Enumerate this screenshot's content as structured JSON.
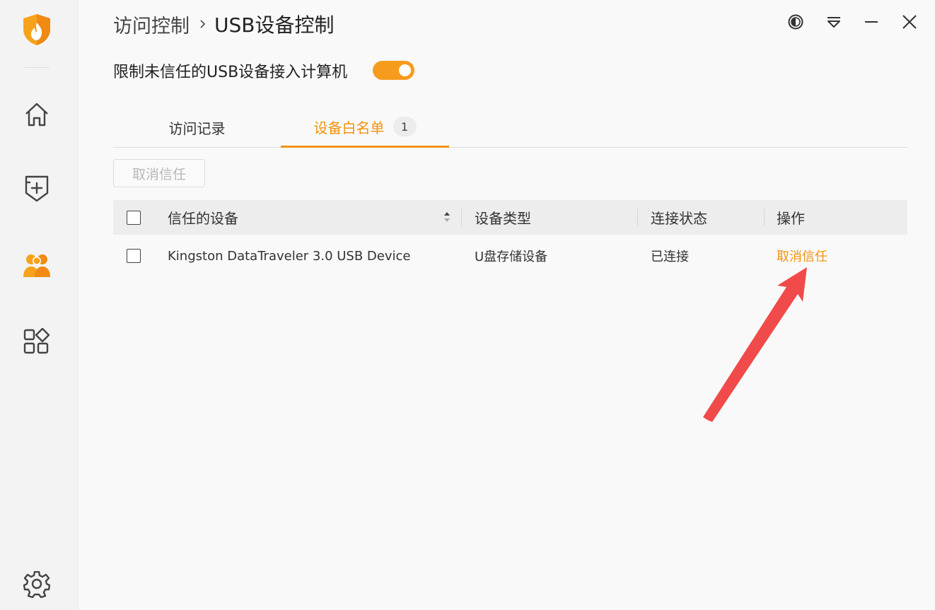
{
  "window": {
    "breadcrumb_parent": "访问控制",
    "breadcrumb_current": "USB设备控制",
    "controls": [
      "theme-icon",
      "menu-icon",
      "minimize-icon",
      "close-icon"
    ]
  },
  "sidebar": {
    "items": [
      {
        "icon": "home-icon",
        "active": false
      },
      {
        "icon": "shield-plus-icon",
        "active": false
      },
      {
        "icon": "users-icon",
        "active": true
      },
      {
        "icon": "apps-icon",
        "active": false
      }
    ],
    "footer_icon": "settings-icon"
  },
  "restriction": {
    "label": "限制未信任的USB设备接入计算机",
    "enabled": true
  },
  "tabs": [
    {
      "label": "访问记录",
      "active": false
    },
    {
      "label": "设备白名单",
      "active": true,
      "badge": "1"
    }
  ],
  "toolbar": {
    "untrust_label": "取消信任",
    "untrust_enabled": false
  },
  "table": {
    "columns": [
      "信任的设备",
      "设备类型",
      "连接状态",
      "操作"
    ],
    "rows": [
      {
        "device": "Kingston DataTraveler 3.0 USB Device",
        "type": "U盘存储设备",
        "status": "已连接",
        "action": "取消信任",
        "checked": false
      }
    ]
  },
  "colors": {
    "accent": "#f2930f",
    "annotation_arrow": "#f04a4a"
  }
}
